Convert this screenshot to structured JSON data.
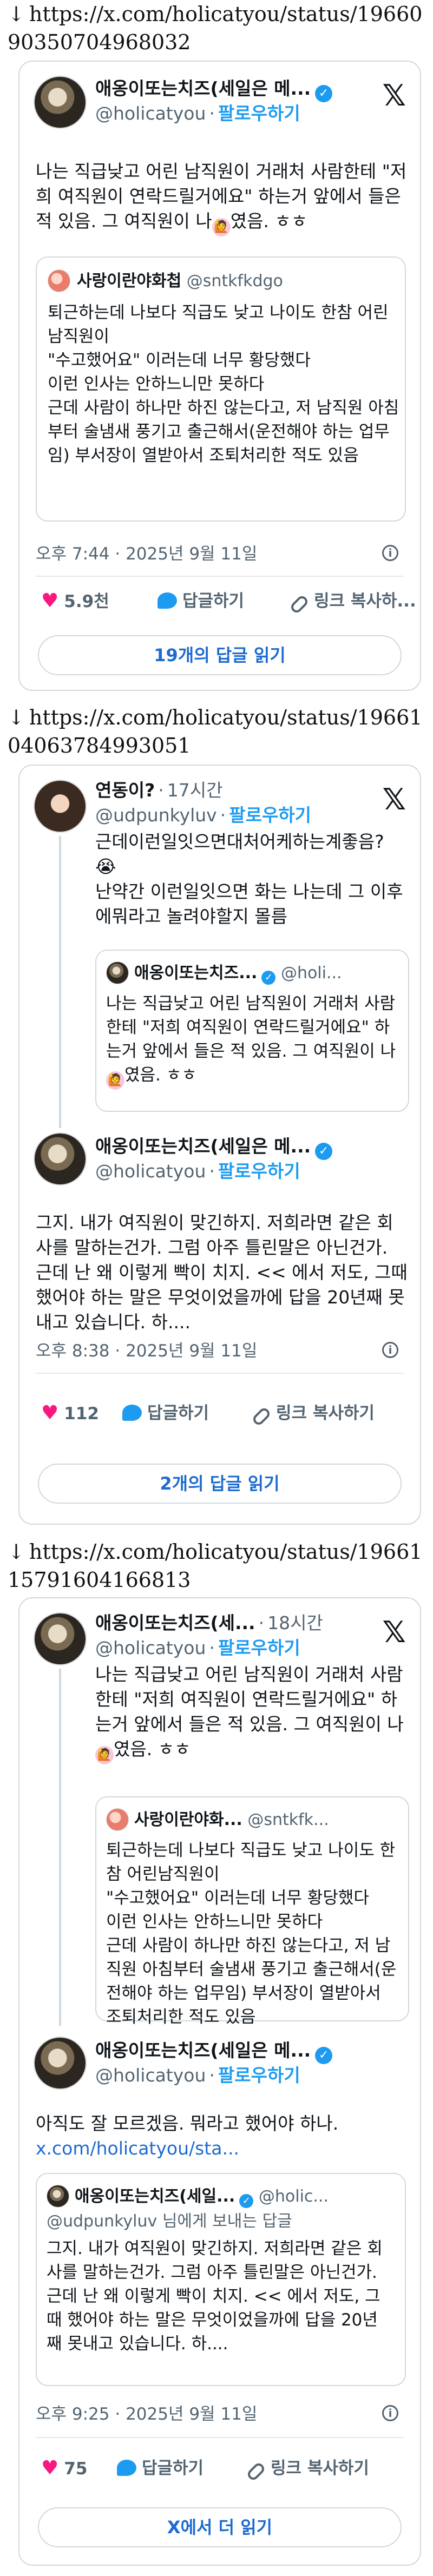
{
  "urls": [
    {
      "arrow": "↓",
      "text": "https://x.com/holicatyou/status/1966090350704968032"
    },
    {
      "arrow": "↓",
      "text": "https://x.com/holicatyou/status/1966104063784993051"
    },
    {
      "arrow": "↓",
      "text": "https://x.com/holicatyou/status/1966115791604166813"
    }
  ],
  "tweet1": {
    "name": "애옹이또는치즈(세일은 메...",
    "handle": "@holicatyou",
    "follow": "팔로우하기",
    "text_a": "나는 직급낮고 어린 남직원이 거래처 사람한테 \"저희 여직원이 연락드릴거에요\" 하는거 앞에서 들은 적 있음. 그 여직원이 나",
    "text_b": "였음. ㅎㅎ",
    "quote": {
      "name": "사랑이란야화첩",
      "handle": "@sntkfkdgo",
      "text": "퇴근하는데 나보다 직급도 낮고 나이도 한참 어린남직원이\n\"수고했어요\" 이러는데 너무 황당했다\n이런 인사는 안하느니만 못하다\n근데 사람이 하나만 하진 않는다고, 저 남직원 아침부터 술냄새 풍기고 출근해서(운전해야 하는 업무임) 부서장이 열받아서 조퇴처리한 적도 있음"
    },
    "time": "오후 7:44 · 2025년 9월 11일",
    "likes": "5.9천",
    "reply_label": "답글하기",
    "copy_label": "링크 복사하...",
    "replies_button": "19개의 답글 읽기"
  },
  "tweet2": {
    "parent": {
      "name": "연동이?",
      "time": "17시간",
      "handle": "@udpunkyluv",
      "follow": "팔로우하기",
      "text": "근데이런일잇으면대처어케하는계좋음? 😭\n난약간 이런일잇으면 화는 나는데 그 이후에뭐라고 놀려야할지 몰름",
      "quote": {
        "name": "애옹이또는치즈...",
        "handle": "@holi...",
        "text_a": "나는 직급낮고 어린 남직원이 거래처 사람한테 \"저희 여직원이 연락드릴거에요\" 하는거 앞에서 들은 적 있음. 그 여직원이 나",
        "text_b": "였음. ㅎㅎ"
      }
    },
    "main": {
      "name": "애옹이또는치즈(세일은 메...",
      "handle": "@holicatyou",
      "follow": "팔로우하기",
      "text": "그지. 내가 여직원이 맞긴하지. 저희라면 같은 회사를 말하는건가. 그럼 아주 틀린말은 아닌건가. 근데 난 왜 이렇게 빡이 치지. << 에서 저도, 그때 했어야 하는 말은 무엇이었을까에 답을 20년째 못내고 있습니다. 하....",
      "time": "오후 8:38 · 2025년 9월 11일",
      "likes": "112",
      "reply_label": "답글하기",
      "copy_label": "링크 복사하기",
      "replies_button": "2개의 답글 읽기"
    }
  },
  "tweet3": {
    "parent": {
      "name": "애옹이또는치즈(세...",
      "time": "18시간",
      "handle": "@holicatyou",
      "follow": "팔로우하기",
      "text_a": "나는 직급낮고 어린 남직원이 거래처 사람한테 \"저희 여직원이 연락드릴거에요\" 하는거 앞에서 들은 적 있음. 그 여직원이 나",
      "text_b": "였음. ㅎㅎ",
      "quote": {
        "name": "사랑이란야화...",
        "handle": "@sntkfk...",
        "text": "퇴근하는데 나보다 직급도 낮고 나이도 한참 어린남직원이\n\"수고했어요\" 이러는데 너무 황당했다\n이런 인사는 안하느니만 못하다\n근데 사람이 하나만 하진 않는다고, 저 남직원 아침부터 술냄새 풍기고 출근해서(운전해야 하는 업무임) 부서장이 열받아서 조퇴처리한 적도 있음"
      }
    },
    "main": {
      "name": "애옹이또는치즈(세일은 메...",
      "handle": "@holicatyou",
      "follow": "팔로우하기",
      "text": "아직도 잘 모르겠음. 뭐라고 했어야 하나.",
      "link": "x.com/holicatyou/sta...",
      "quote": {
        "name": "애옹이또는치즈(세일...",
        "handle": "@holic...",
        "reply_to": "@udpunkyluv 님에게 보내는 답글",
        "text": "그지. 내가 여직원이 맞긴하지. 저희라면 같은 회사를 말하는건가. 그럼 아주 틀린말은 아닌건가. 근데 난 왜 이렇게 빡이 치지. << 에서 저도, 그때 했어야 하는 말은 무엇이었을까에 답을 20년째 못내고 있습니다. 하...."
      },
      "time": "오후 9:25 · 2025년 9월 11일",
      "likes": "75",
      "reply_label": "답글하기",
      "copy_label": "링크 복사하기",
      "more_button": "X에서 더 읽기"
    }
  },
  "icons": {
    "x": "𝕏",
    "verified": "✓",
    "info": "i",
    "heart": "♥",
    "arrow": "↓"
  },
  "colors": {
    "accent": "#1d9bf0",
    "heart": "#f91880",
    "link": "#1d6bd0",
    "border": "#cfd9de"
  }
}
